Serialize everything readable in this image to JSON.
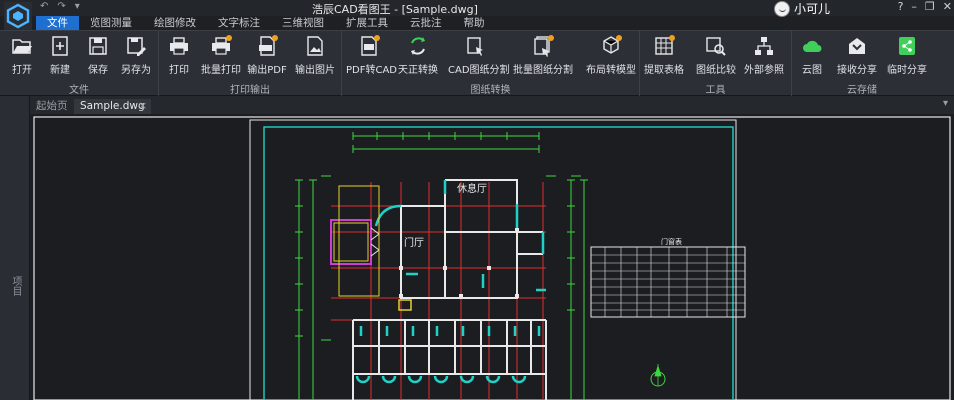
{
  "titlebar": {
    "title": "浩辰CAD看图王 - [Sample.dwg]",
    "user_name": "小可儿",
    "qat": [
      "↶",
      "↷",
      "▾"
    ],
    "controls": [
      "?",
      "–",
      "❐",
      "✕"
    ]
  },
  "menu": {
    "tabs": [
      "文件",
      "览图测量",
      "绘图修改",
      "文字标注",
      "三维视图",
      "扩展工具",
      "云批注",
      "帮助"
    ],
    "active": "文件"
  },
  "ribbon": {
    "groups": [
      {
        "label": "文件",
        "tools": [
          "打开",
          "新建",
          "保存",
          "另存为"
        ]
      },
      {
        "label": "打印输出",
        "tools": [
          "打印",
          "批量打印",
          "输出PDF",
          "输出图片"
        ]
      },
      {
        "label": "图纸转换",
        "tools": [
          "PDF转CAD",
          "天正转换",
          "CAD图纸分割",
          "批量图纸分割",
          "布局转模型"
        ]
      },
      {
        "label": "工具",
        "tools": [
          "提取表格",
          "图纸比较",
          "外部参照"
        ]
      },
      {
        "label": "云存储",
        "tools": [
          "云图",
          "接收分享",
          "临时分享"
        ]
      }
    ]
  },
  "doctabs": {
    "start": "起始页",
    "active": "Sample.dwg",
    "close": "×",
    "menu": "▾"
  },
  "sidebar": {
    "label": "项目"
  },
  "drawing": {
    "room_lobby": "门厅",
    "room_lounge": "休息厅",
    "table_title": "门窗表",
    "colors": {
      "frame": "#1fd1c6",
      "grid": "#e0302d",
      "dims": "#3fd63f",
      "walls": "#e8e8e8",
      "accent": "#d23bd2",
      "yellow": "#e3d22b"
    }
  }
}
